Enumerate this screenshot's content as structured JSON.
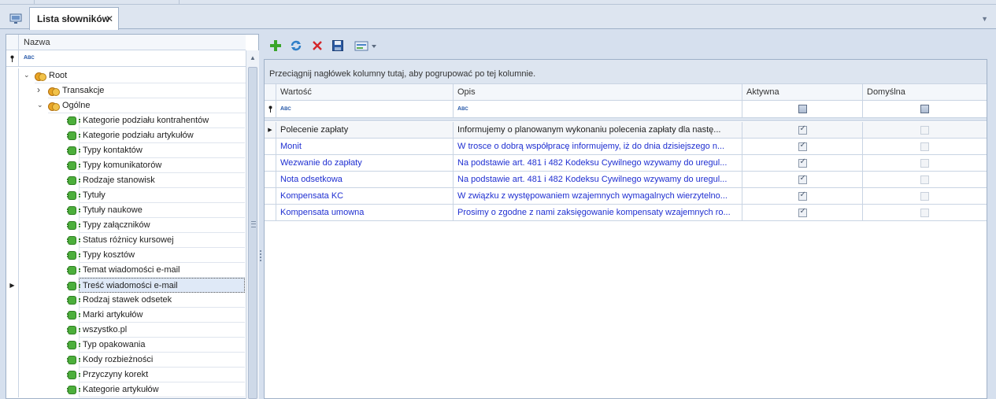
{
  "tab": {
    "title": "Lista słowników",
    "close": "✕"
  },
  "tree": {
    "column_header": "Nazwa",
    "rows": [
      {
        "label": "Root",
        "level": 0,
        "kind": "folder",
        "expanded": true
      },
      {
        "label": "Transakcje",
        "level": 1,
        "kind": "folder",
        "expanded": false
      },
      {
        "label": "Ogólne",
        "level": 1,
        "kind": "folder",
        "expanded": true
      },
      {
        "label": "Kategorie podziału kontrahentów",
        "level": 2,
        "kind": "item"
      },
      {
        "label": "Kategorie podziału artykułów",
        "level": 2,
        "kind": "item"
      },
      {
        "label": "Typy kontaktów",
        "level": 2,
        "kind": "item"
      },
      {
        "label": "Typy komunikatorów",
        "level": 2,
        "kind": "item"
      },
      {
        "label": "Rodzaje stanowisk",
        "level": 2,
        "kind": "item"
      },
      {
        "label": "Tytuły",
        "level": 2,
        "kind": "item"
      },
      {
        "label": "Tytuły naukowe",
        "level": 2,
        "kind": "item"
      },
      {
        "label": "Typy załączników",
        "level": 2,
        "kind": "item"
      },
      {
        "label": "Status różnicy kursowej",
        "level": 2,
        "kind": "item"
      },
      {
        "label": "Typy kosztów",
        "level": 2,
        "kind": "item"
      },
      {
        "label": "Temat wiadomości e-mail",
        "level": 2,
        "kind": "item"
      },
      {
        "label": "Treść wiadomości e-mail",
        "level": 2,
        "kind": "item",
        "selected": true
      },
      {
        "label": "Rodzaj stawek odsetek",
        "level": 2,
        "kind": "item"
      },
      {
        "label": "Marki artykułów",
        "level": 2,
        "kind": "item"
      },
      {
        "label": "wszystko.pl",
        "level": 2,
        "kind": "item"
      },
      {
        "label": "Typ opakowania",
        "level": 2,
        "kind": "item"
      },
      {
        "label": "Kody rozbieżności",
        "level": 2,
        "kind": "item"
      },
      {
        "label": "Przyczyny korekt",
        "level": 2,
        "kind": "item"
      },
      {
        "label": "Kategorie artykułów",
        "level": 2,
        "kind": "item"
      }
    ]
  },
  "toolbar": {
    "add_icon": "plus-icon",
    "refresh_icon": "refresh-icon",
    "delete_icon": "delete-icon",
    "save_icon": "save-icon",
    "export_icon": "export-icon"
  },
  "grid": {
    "group_panel_text": "Przeciągnij nagłówek kolumny tutaj, aby pogrupować po tej kolumnie.",
    "columns": [
      "Wartość",
      "Opis",
      "Aktywna",
      "Domyślna"
    ],
    "rows": [
      {
        "value": "Polecenie zapłaty",
        "desc": "Informujemy o planowanym wykonaniu polecenia zapłaty dla nastę...",
        "active": true,
        "default": false,
        "current": true
      },
      {
        "value": "Monit",
        "desc": "W trosce o dobrą współpracę informujemy, iż do dnia dzisiejszego n...",
        "active": true,
        "default": false
      },
      {
        "value": "Wezwanie do zapłaty",
        "desc": "Na podstawie art. 481 i 482 Kodeksu Cywilnego wzywamy do uregul...",
        "active": true,
        "default": false
      },
      {
        "value": "Nota odsetkowa",
        "desc": "Na podstawie art. 481 i 482 Kodeksu Cywilnego wzywamy do uregul...",
        "active": true,
        "default": false
      },
      {
        "value": "Kompensata KC",
        "desc": "W związku z występowaniem wzajemnych wymagalnych wierzytelno...",
        "active": true,
        "default": false
      },
      {
        "value": "Kompensata umowna",
        "desc": "Prosimy o zgodne z nami zaksięgowanie kompensaty wzajemnych ro...",
        "active": true,
        "default": false
      }
    ]
  }
}
